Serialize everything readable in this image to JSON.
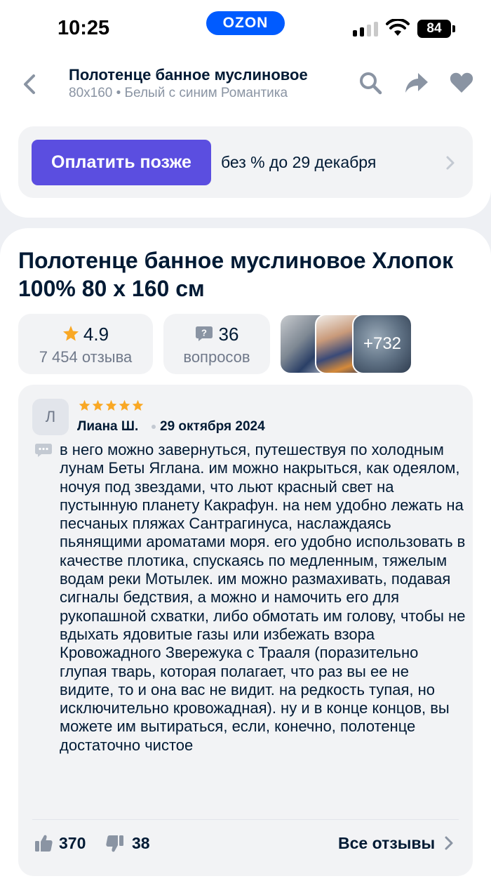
{
  "status_bar": {
    "time": "10:25",
    "battery": "84",
    "logo": "OZON"
  },
  "header": {
    "title": "Полотенце банное муслиновое",
    "subtitle": "80x160 • Белый с синим Романтика"
  },
  "pay_later": {
    "button": "Оплатить позже",
    "text": "без % до 29 декабря"
  },
  "product": {
    "title": "Полотенце банное муслиновое Хлопок 100% 80 х 160 см",
    "rating": "4.9",
    "reviews_count": "7 454 отзыва",
    "questions_count": "36",
    "questions_label": "вопросов",
    "photos_more": "+732"
  },
  "review": {
    "avatar_letter": "Л",
    "stars": 5,
    "author": "Лиана Ш.",
    "date": "29 октября 2024",
    "text": "в него можно завернуться, путешествуя по холодным лунам Беты Яглана. им можно накрыться, как одеялом, ночуя под звездами, что льют красный свет на пустынную планету Какрафун. на нем удобно лежать на песчаных пляжах Сантрагинуса, наслаждаясь пьянящими ароматами моря. его удобно использовать в качестве плотика, спускаясь по медленным, тяжелым водам реки Мотылек. им можно размахивать, подавая сигналы бедствия, а можно и намочить его для рукопашной схватки, либо обмотать им голову, чтобы не вдыхать ядовитые газы или избежать взора Кровожадного Звережука с Трааля (поразительно глупая тварь, которая полагает, что раз вы ее не видите, то и она вас не видит. на редкость тупая, но исключительно кровожадная). ну и в конце концов, вы можете им вытираться, если, конечно, полотенце достаточно чистое",
    "likes": "370",
    "dislikes": "38",
    "all_reviews": "Все отзывы"
  },
  "colors": {
    "brand": "#005bff",
    "pay_button": "#5b4ee0",
    "star": "#f9a825",
    "text": "#001a34",
    "secondary_text": "#70798a"
  }
}
